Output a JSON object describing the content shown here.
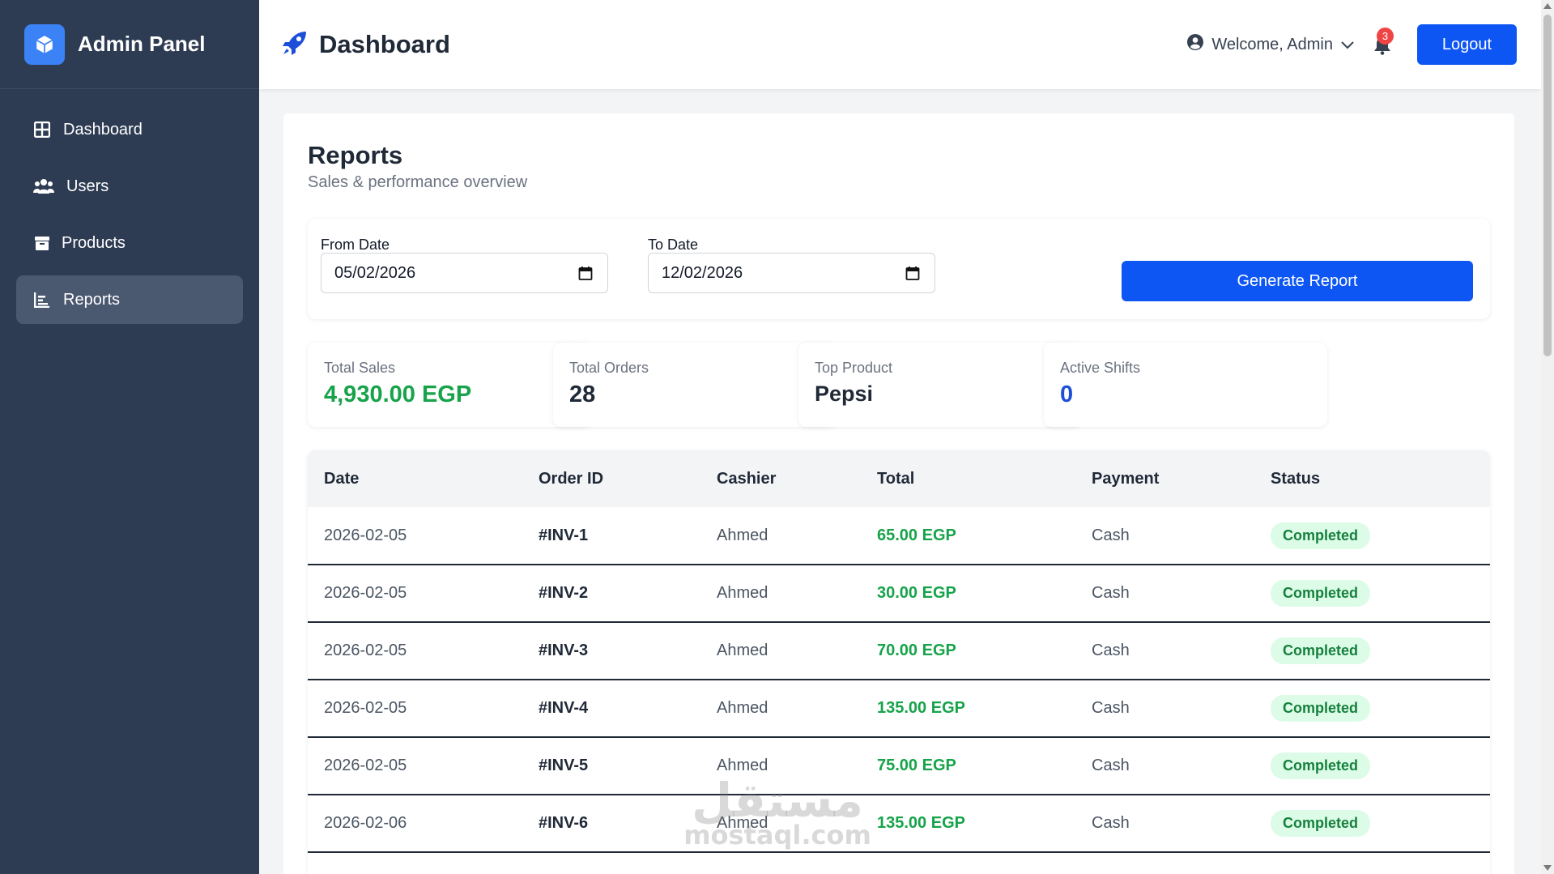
{
  "sidebar": {
    "title": "Admin Panel",
    "items": [
      {
        "label": "Dashboard",
        "icon": "grid-icon"
      },
      {
        "label": "Users",
        "icon": "users-icon"
      },
      {
        "label": "Products",
        "icon": "box-icon"
      },
      {
        "label": "Reports",
        "icon": "chart-icon",
        "active": true
      }
    ]
  },
  "header": {
    "title": "Dashboard",
    "welcome": "Welcome, Admin",
    "notifications": "3",
    "logout": "Logout"
  },
  "reports": {
    "title": "Reports",
    "subtitle": "Sales & performance overview",
    "from_label": "From Date",
    "from_value": "05/02/2026",
    "to_label": "To Date",
    "to_value": "12/02/2026",
    "generate": "Generate Report"
  },
  "stats": [
    {
      "label": "Total Sales",
      "value": "4,930.00 EGP",
      "color": "#16a34a"
    },
    {
      "label": "Total Orders",
      "value": "28",
      "color": "#1f2937"
    },
    {
      "label": "Top Product",
      "value": "Pepsi",
      "color": "#1f2937"
    },
    {
      "label": "Active Shifts",
      "value": "0",
      "color": "#1d4ed8"
    }
  ],
  "table": {
    "headers": [
      "Date",
      "Order ID",
      "Cashier",
      "Total",
      "Payment",
      "Status"
    ],
    "rows": [
      {
        "date": "2026-02-05",
        "order": "#INV-1",
        "cashier": "Ahmed",
        "total": "65.00 EGP",
        "payment": "Cash",
        "status": "Completed"
      },
      {
        "date": "2026-02-05",
        "order": "#INV-2",
        "cashier": "Ahmed",
        "total": "30.00 EGP",
        "payment": "Cash",
        "status": "Completed"
      },
      {
        "date": "2026-02-05",
        "order": "#INV-3",
        "cashier": "Ahmed",
        "total": "70.00 EGP",
        "payment": "Cash",
        "status": "Completed"
      },
      {
        "date": "2026-02-05",
        "order": "#INV-4",
        "cashier": "Ahmed",
        "total": "135.00 EGP",
        "payment": "Cash",
        "status": "Completed"
      },
      {
        "date": "2026-02-05",
        "order": "#INV-5",
        "cashier": "Ahmed",
        "total": "75.00 EGP",
        "payment": "Cash",
        "status": "Completed"
      },
      {
        "date": "2026-02-06",
        "order": "#INV-6",
        "cashier": "Ahmed",
        "total": "135.00 EGP",
        "payment": "Cash",
        "status": "Completed"
      }
    ]
  },
  "watermark": "mostaql.com"
}
